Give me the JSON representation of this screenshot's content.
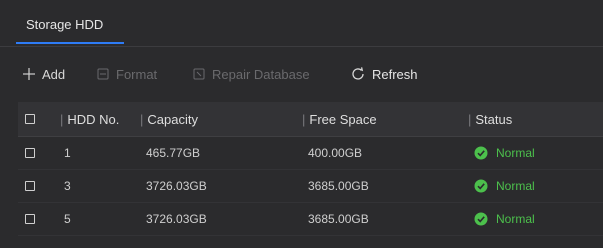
{
  "tab": {
    "label": "Storage HDD"
  },
  "toolbar": {
    "add": "Add",
    "format": "Format",
    "repair": "Repair Database",
    "refresh": "Refresh"
  },
  "table": {
    "headers": {
      "hdd": "HDD No.",
      "capacity": "Capacity",
      "free": "Free Space",
      "status": "Status"
    },
    "rows": [
      {
        "hdd": "1",
        "capacity": "465.77GB",
        "free": "400.00GB",
        "status": "Normal"
      },
      {
        "hdd": "3",
        "capacity": "3726.03GB",
        "free": "3685.00GB",
        "status": "Normal"
      },
      {
        "hdd": "5",
        "capacity": "3726.03GB",
        "free": "3685.00GB",
        "status": "Normal"
      }
    ]
  },
  "colors": {
    "accent": "#2e7cf6",
    "ok": "#4cc04c"
  }
}
